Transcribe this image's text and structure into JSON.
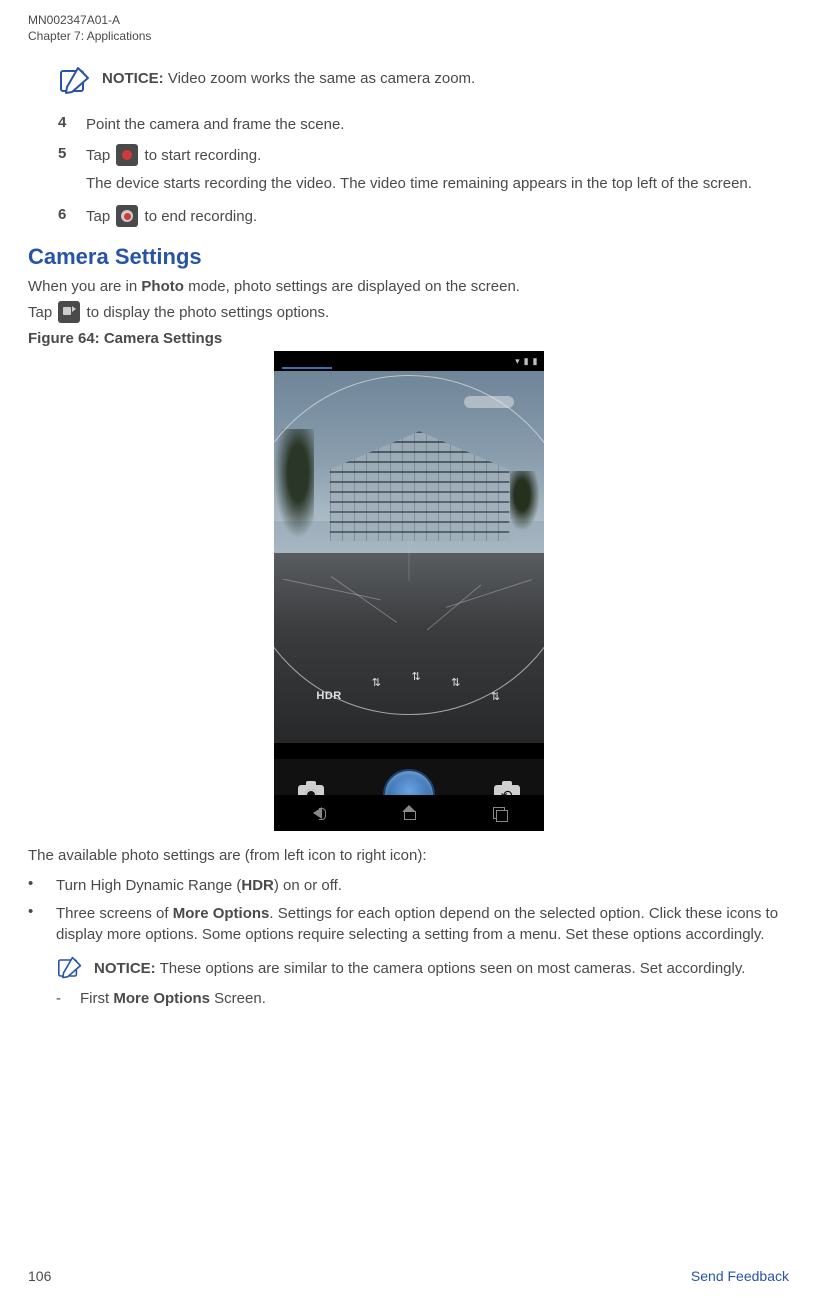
{
  "header": {
    "doc_id": "MN002347A01-A",
    "chapter": "Chapter 7:  Applications"
  },
  "notice1": {
    "label": "NOTICE:",
    "text": " Video zoom works the same as camera zoom."
  },
  "steps": {
    "s4": {
      "num": "4",
      "text": "Point the camera and frame the scene."
    },
    "s5": {
      "num": "5",
      "pre": "Tap ",
      "post": " to start recording.",
      "sub": "The device starts recording the video. The video time remaining appears in the top left of the screen."
    },
    "s6": {
      "num": "6",
      "pre": "Tap ",
      "post": " to end recording."
    }
  },
  "section": {
    "title": "Camera Settings",
    "intro_pre": "When you are in ",
    "intro_bold": "Photo",
    "intro_post": " mode, photo settings are displayed on the screen.",
    "tap_pre": "Tap ",
    "tap_post": " to display the photo settings options.",
    "fig_label": "Figure 64: Camera Settings"
  },
  "phone": {
    "hdr": "HDR",
    "opt": "⇅"
  },
  "list": {
    "intro": "The available photo settings are (from left icon to right icon):",
    "b1_pre": "Turn High Dynamic Range (",
    "b1_bold": "HDR",
    "b1_post": ") on or off.",
    "b2_pre": "Three screens of ",
    "b2_bold": "More Options",
    "b2_post": ". Settings for each option depend on the selected option. Click these icons to display more options. Some options require selecting a setting from a menu. Set these options accordingly.",
    "notice2_label": "NOTICE:",
    "notice2_text": " These options are similar to the camera options seen on most cameras. Set accordingly.",
    "dash_pre": "First ",
    "dash_bold": "More Options",
    "dash_post": " Screen."
  },
  "footer": {
    "page": "106",
    "link": "Send Feedback"
  }
}
